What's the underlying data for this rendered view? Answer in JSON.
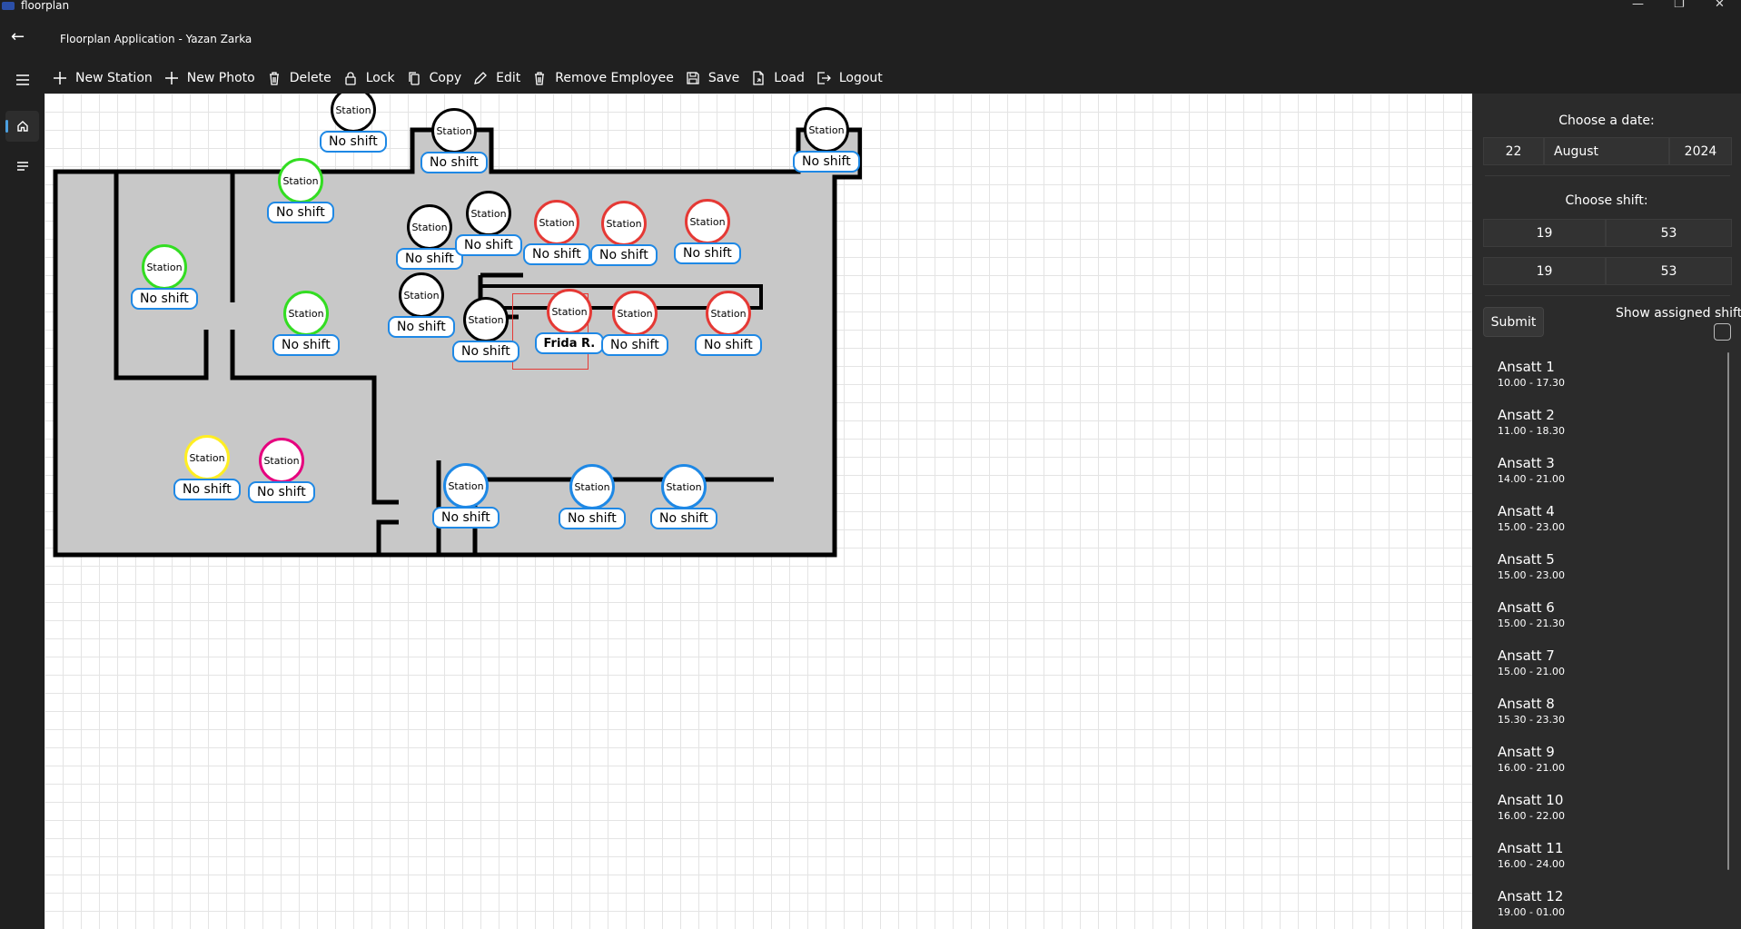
{
  "window": {
    "app_name": "floorplan",
    "minimize": "—",
    "maximize": "❐",
    "close": "✕"
  },
  "header": {
    "back": "←",
    "title": "Floorplan Application - Yazan Zarka"
  },
  "toolbar": {
    "new_station": "New Station",
    "new_photo": "New Photo",
    "delete": "Delete",
    "lock": "Lock",
    "copy": "Copy",
    "edit": "Edit",
    "remove_employee": "Remove Employee",
    "save": "Save",
    "load": "Load",
    "logout": "Logout"
  },
  "colors": {
    "black": "#000000",
    "green": "#33dd22",
    "red": "#e53935",
    "blue": "#1e88e5",
    "yellow": "#ffee22",
    "magenta": "#e6007e",
    "wall": "#000000",
    "floor": "#c8c8c8"
  },
  "stations": [
    {
      "label": "Station",
      "shift": "No shift",
      "color": "black"
    },
    {
      "label": "Station",
      "shift": "No shift",
      "color": "black"
    },
    {
      "label": "Station",
      "shift": "No shift",
      "color": "black"
    },
    {
      "label": "Station",
      "shift": "No shift",
      "color": "green"
    },
    {
      "label": "Station",
      "shift": "No shift",
      "color": "black"
    },
    {
      "label": "Station",
      "shift": "No shift",
      "color": "black"
    },
    {
      "label": "Station",
      "shift": "No shift",
      "color": "red"
    },
    {
      "label": "Station",
      "shift": "No shift",
      "color": "red"
    },
    {
      "label": "Station",
      "shift": "No shift",
      "color": "red"
    },
    {
      "label": "Station",
      "shift": "No shift",
      "color": "green"
    },
    {
      "label": "Station",
      "shift": "No shift",
      "color": "black"
    },
    {
      "label": "Station",
      "shift": "No shift",
      "color": "green"
    },
    {
      "label": "Station",
      "shift": "No shift",
      "color": "black"
    },
    {
      "label": "Station",
      "shift": "Frida R.",
      "color": "red",
      "selected": true
    },
    {
      "label": "Station",
      "shift": "No shift",
      "color": "red"
    },
    {
      "label": "Station",
      "shift": "No shift",
      "color": "red"
    },
    {
      "label": "Station",
      "shift": "No shift",
      "color": "yellow"
    },
    {
      "label": "Station",
      "shift": "No shift",
      "color": "magenta"
    },
    {
      "label": "Station",
      "shift": "No shift",
      "color": "blue"
    },
    {
      "label": "Station",
      "shift": "No shift",
      "color": "blue"
    },
    {
      "label": "Station",
      "shift": "No shift",
      "color": "blue"
    }
  ],
  "panel": {
    "date_label": "Choose a date:",
    "date_day": "22",
    "date_month": "August",
    "date_year": "2024",
    "shift_label": "Choose shift:",
    "shift_start_hour": "19",
    "shift_start_min": "53",
    "shift_end_hour": "19",
    "shift_end_min": "53",
    "submit": "Submit",
    "show_assigned": "Show assigned shifts",
    "show_assigned_checked": false
  },
  "employees": [
    {
      "name": "Ansatt 1",
      "time": "10.00 - 17.30"
    },
    {
      "name": "Ansatt 2",
      "time": "11.00 - 18.30"
    },
    {
      "name": "Ansatt 3",
      "time": "14.00 - 21.00"
    },
    {
      "name": "Ansatt 4",
      "time": "15.00 - 23.00"
    },
    {
      "name": "Ansatt 5",
      "time": "15.00 - 23.00"
    },
    {
      "name": "Ansatt 6",
      "time": "15.00 - 21.30"
    },
    {
      "name": "Ansatt 7",
      "time": "15.00 - 21.00"
    },
    {
      "name": "Ansatt 8",
      "time": "15.30 - 23.30"
    },
    {
      "name": "Ansatt 9",
      "time": "16.00 - 21.00"
    },
    {
      "name": "Ansatt 10",
      "time": "16.00 - 22.00"
    },
    {
      "name": "Ansatt 11",
      "time": "16.00 - 24.00"
    },
    {
      "name": "Ansatt 12",
      "time": "19.00 - 01.00"
    }
  ]
}
